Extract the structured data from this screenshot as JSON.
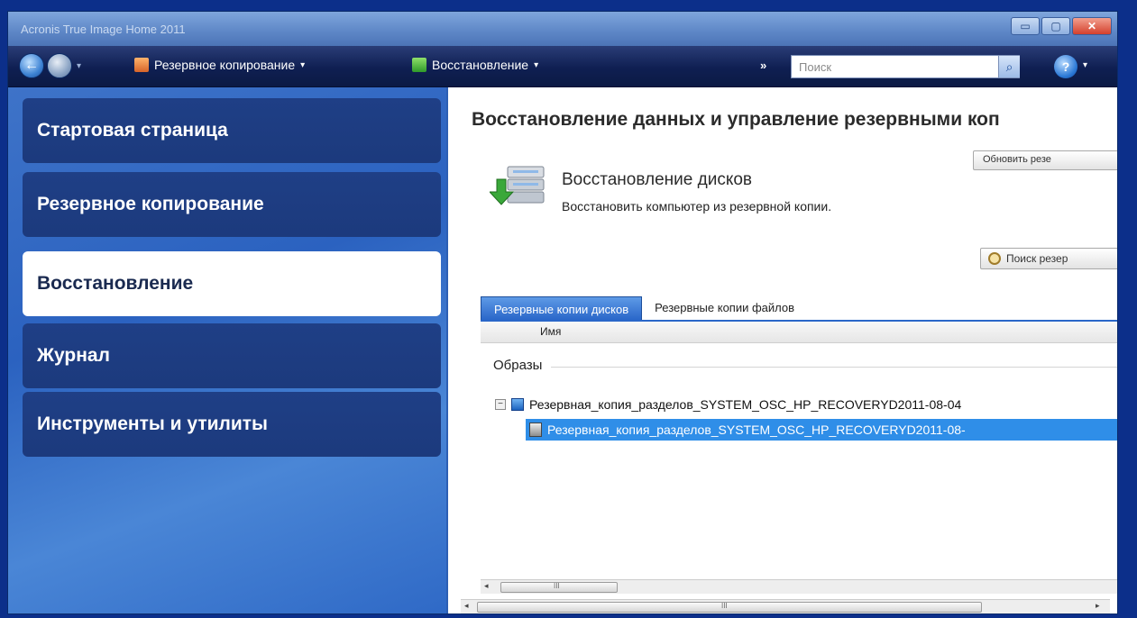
{
  "window": {
    "title": "Acronis True Image Home 2011",
    "min_glyph": "▭",
    "max_glyph": "▢",
    "close_glyph": "✕"
  },
  "toolbar": {
    "back_glyph": "←",
    "dropdown_glyph": "▾",
    "menu_backup": "Резервное копирование",
    "menu_recovery": "Восстановление",
    "menu_caret": "▾",
    "more_glyph": "»",
    "search_placeholder": "Поиск",
    "search_glyph": "⌕",
    "help_glyph": "?",
    "help_caret": "▾"
  },
  "sidebar": {
    "items": [
      {
        "label": "Стартовая страница"
      },
      {
        "label": "Резервное копирование"
      },
      {
        "label": "Восстановление",
        "active": true
      },
      {
        "label": "Журнал"
      },
      {
        "label": "Инструменты и утилиты"
      }
    ]
  },
  "main": {
    "title": "Восстановление данных и управление резервными коп",
    "refresh_button": "Обновить резе",
    "section_title": "Восстановление дисков",
    "section_desc": "Восстановить компьютер из резервной копии.",
    "find_button": "Поиск резер",
    "tabs": [
      {
        "label": "Резервные копии дисков",
        "active": true
      },
      {
        "label": "Резервные копии файлов"
      }
    ],
    "column_name": "Имя",
    "group_label": "Образы",
    "tree_parent": "Резервная_копия_разделов_SYSTEM_OSC_HP_RECOVERYD2011-08-04",
    "tree_child": "Резервная_копия_разделов_SYSTEM_OSC_HP_RECOVERYD2011-08-",
    "scroll_left": "◂",
    "scroll_right": "▸",
    "scroll_grip": "III"
  },
  "colors": {
    "accent": "#2f8ee8",
    "sidebar_bg": "#2b62c0",
    "toolbar_bg": "#0f1f52"
  }
}
